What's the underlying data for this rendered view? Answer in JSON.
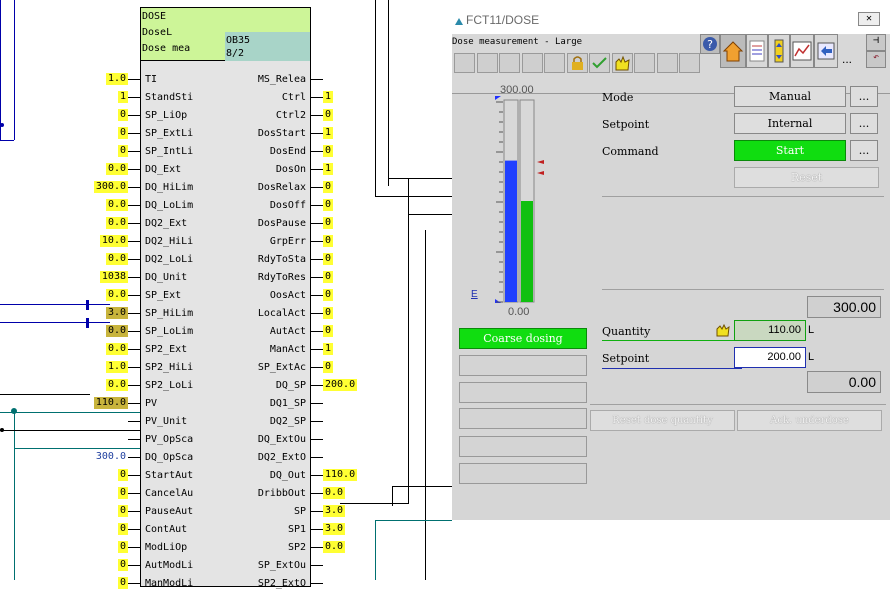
{
  "block": {
    "header": {
      "line1": "DOSE",
      "line2": "DoseL",
      "line3": "Dose mea",
      "ob": "OB35",
      "ob_sub": "8/2"
    },
    "inputs": [
      {
        "value": "1.0",
        "name": "TI",
        "style": "yel"
      },
      {
        "value": "1",
        "name": "StandSti",
        "style": "yel"
      },
      {
        "value": "0",
        "name": "SP_LiOp",
        "style": "yel"
      },
      {
        "value": "0",
        "name": "SP_ExtLi",
        "style": "yel"
      },
      {
        "value": "0",
        "name": "SP_IntLi",
        "style": "yel"
      },
      {
        "value": "0.0",
        "name": "DQ_Ext",
        "style": "yel"
      },
      {
        "value": "300.0",
        "name": "DQ_HiLim",
        "style": "yel"
      },
      {
        "value": "0.0",
        "name": "DQ_LoLim",
        "style": "yel"
      },
      {
        "value": "0.0",
        "name": "DQ2_Ext",
        "style": "yel"
      },
      {
        "value": "10.0",
        "name": "DQ2_HiLi",
        "style": "yel"
      },
      {
        "value": "0.0",
        "name": "DQ2_LoLi",
        "style": "yel"
      },
      {
        "value": "1038",
        "name": "DQ_Unit",
        "style": "yel"
      },
      {
        "value": "0.0",
        "name": "SP_Ext",
        "style": "yel"
      },
      {
        "value": "3.0",
        "name": "SP_HiLim",
        "style": "olive"
      },
      {
        "value": "0.0",
        "name": "SP_LoLim",
        "style": "olive"
      },
      {
        "value": "0.0",
        "name": "SP2_Ext",
        "style": "yel"
      },
      {
        "value": "1.0",
        "name": "SP2_HiLi",
        "style": "yel"
      },
      {
        "value": "0.0",
        "name": "SP2_LoLi",
        "style": "yel"
      },
      {
        "value": "110.0",
        "name": "PV",
        "style": "olive"
      },
      {
        "value": "",
        "name": "PV_Unit",
        "style": ""
      },
      {
        "value": "",
        "name": "PV_OpSca",
        "style": ""
      },
      {
        "value": "300.0",
        "name": "DQ_OpSca",
        "style": "blu"
      },
      {
        "value": "0",
        "name": "StartAut",
        "style": "yel"
      },
      {
        "value": "0",
        "name": "CancelAu",
        "style": "yel"
      },
      {
        "value": "0",
        "name": "PauseAut",
        "style": "yel"
      },
      {
        "value": "0",
        "name": "ContAut",
        "style": "yel"
      },
      {
        "value": "0",
        "name": "ModLiOp",
        "style": "yel"
      },
      {
        "value": "0",
        "name": "AutModLi",
        "style": "yel"
      },
      {
        "value": "0",
        "name": "ManModLi",
        "style": "yel"
      }
    ],
    "outputs": [
      {
        "name": "MS_Relea",
        "value": ""
      },
      {
        "name": "Ctrl",
        "value": "1"
      },
      {
        "name": "Ctrl2",
        "value": "0"
      },
      {
        "name": "DosStart",
        "value": "1"
      },
      {
        "name": "DosEnd",
        "value": "0"
      },
      {
        "name": "DosOn",
        "value": "1"
      },
      {
        "name": "DosRelax",
        "value": "0"
      },
      {
        "name": "DosOff",
        "value": "0"
      },
      {
        "name": "DosPause",
        "value": "0"
      },
      {
        "name": "GrpErr",
        "value": "0"
      },
      {
        "name": "RdyToSta",
        "value": "0"
      },
      {
        "name": "RdyToRes",
        "value": "0"
      },
      {
        "name": "OosAct",
        "value": "0"
      },
      {
        "name": "LocalAct",
        "value": "0"
      },
      {
        "name": "AutAct",
        "value": "0"
      },
      {
        "name": "ManAct",
        "value": "1"
      },
      {
        "name": "SP_ExtAc",
        "value": "0"
      },
      {
        "name": "DQ_SP",
        "value": "200.0"
      },
      {
        "name": "DQ1_SP",
        "value": ""
      },
      {
        "name": "DQ2_SP",
        "value": ""
      },
      {
        "name": "DQ_ExtOu",
        "value": ""
      },
      {
        "name": "DQ2_ExtO",
        "value": ""
      },
      {
        "name": "DQ_Out",
        "value": "110.0"
      },
      {
        "name": "DribbOut",
        "value": "0.0"
      },
      {
        "name": "SP",
        "value": "3.0"
      },
      {
        "name": "SP1",
        "value": "3.0"
      },
      {
        "name": "SP2",
        "value": "0.0"
      },
      {
        "name": "SP_ExtOu",
        "value": ""
      },
      {
        "name": "SP2_ExtO",
        "value": ""
      }
    ]
  },
  "faceplate": {
    "window_title": "FCT11/DOSE",
    "subtitle": "Dose measurement - Large",
    "bar_scale_top": "300.00",
    "bar_scale_bottom": "0.00",
    "bar_blue_fraction": 0.7,
    "bar_green_fraction": 0.5,
    "unit_link": "E",
    "mode_label": "Mode",
    "mode_value": "Manual",
    "setpoint_label": "Setpoint",
    "setpoint_value": "Internal",
    "command_label": "Command",
    "command_value": "Start",
    "reset_label": "Reset",
    "dots": "...",
    "range_high": "300.00",
    "quantity_label": "Quantity",
    "quantity_value": "110.00",
    "quantity_unit": "L",
    "setpoint2_label": "Setpoint",
    "setpoint2_value": "200.00",
    "setpoint2_unit": "L",
    "range_low": "0.00",
    "status_text": "Coarse dosing",
    "reset_dose_label": "Reset dose quantity",
    "ack_underdose_label": "Ack. underdose",
    "colors": {
      "blue_bar": "#2040ff",
      "green_bar": "#10c010",
      "start_green": "#10dd10"
    }
  }
}
